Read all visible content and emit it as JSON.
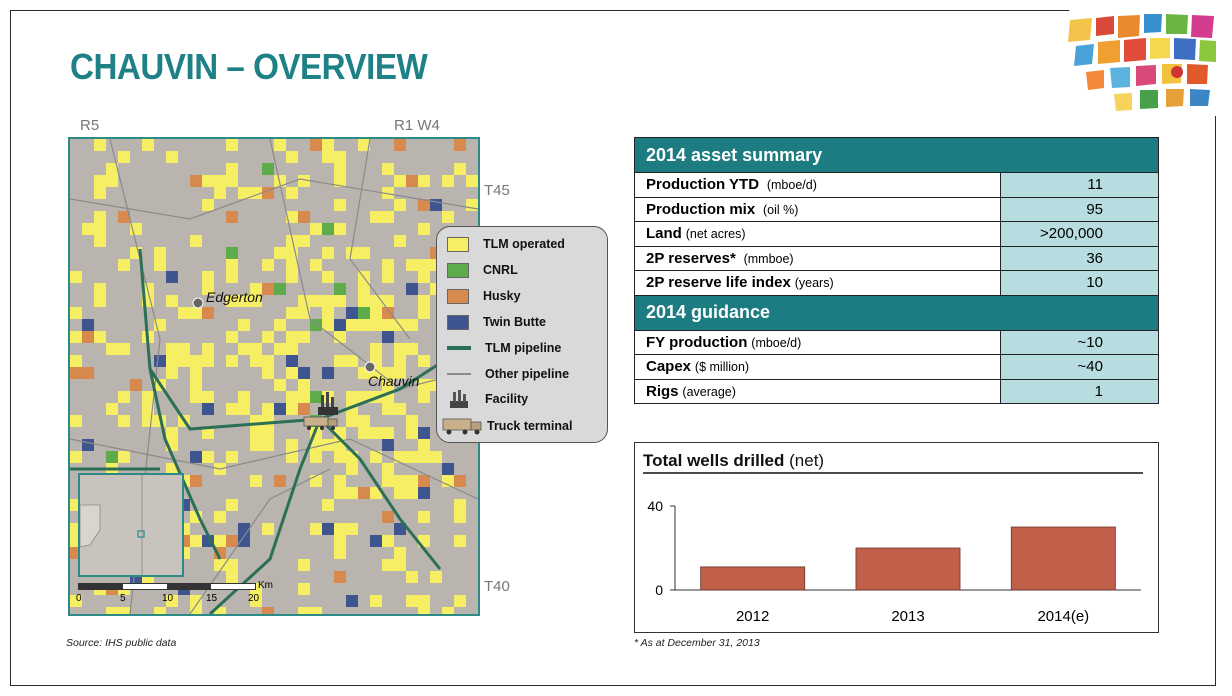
{
  "page": {
    "title": "CHAUVIN – OVERVIEW"
  },
  "map": {
    "range_left": "R5",
    "range_right": "R1 W4",
    "township_top": "T45",
    "township_bottom": "T40",
    "towns": {
      "edgerton": "Edgerton",
      "chauvin": "Chauvin"
    },
    "scale": {
      "ticks": [
        "0",
        "5",
        "10",
        "15",
        "20"
      ],
      "unit": "Km"
    },
    "source": "Source: IHS public data"
  },
  "legend": {
    "items": [
      {
        "label": "TLM operated",
        "color": "#f7ef63",
        "kind": "swatch"
      },
      {
        "label": "CNRL",
        "color": "#5eab4b",
        "kind": "swatch"
      },
      {
        "label": "Husky",
        "color": "#d68a4e",
        "kind": "swatch"
      },
      {
        "label": "Twin Butte",
        "color": "#3e5590",
        "kind": "swatch"
      },
      {
        "label": "TLM pipeline",
        "color": "#2b6f57",
        "kind": "line"
      },
      {
        "label": "Other pipeline",
        "color": "#8a8a8a",
        "kind": "line"
      },
      {
        "label": "Facility",
        "kind": "facility-icon"
      },
      {
        "label": "Truck terminal",
        "kind": "truck-icon"
      }
    ]
  },
  "summary": {
    "asset_header": "2014 asset summary",
    "asset_rows": [
      {
        "label": "Production YTD",
        "unit": "(mboe/d)",
        "value": "11"
      },
      {
        "label": "Production mix",
        "unit": "(oil %)",
        "value": "95"
      },
      {
        "label": "Land",
        "unit": "(net acres)",
        "value": ">200,000"
      },
      {
        "label": "2P reserves*",
        "unit": "(mmboe)",
        "value": "36"
      },
      {
        "label": "2P reserve life index",
        "unit": "(years)",
        "value": "10"
      }
    ],
    "guidance_header": "2014 guidance",
    "guidance_rows": [
      {
        "label": "FY production",
        "unit": "(mboe/d)",
        "value": "~10"
      },
      {
        "label": "Capex",
        "unit": "($ million)",
        "value": "~40"
      },
      {
        "label": "Rigs",
        "unit": "(average)",
        "value": "1"
      }
    ]
  },
  "chart_title": {
    "bold": "Total wells drilled",
    "unit": "(net)"
  },
  "chart_data": {
    "type": "bar",
    "title": "Total wells drilled (net)",
    "categories": [
      "2012",
      "2013",
      "2014(e)"
    ],
    "values": [
      11,
      20,
      30
    ],
    "ylim": [
      0,
      40
    ],
    "yticks": [
      "0",
      "40"
    ],
    "bar_color": "#c0604b"
  },
  "footnote": "* As at December 31, 2013",
  "colors": {
    "accent": "#1d7c81",
    "table_value_bg": "#b8dde0"
  }
}
